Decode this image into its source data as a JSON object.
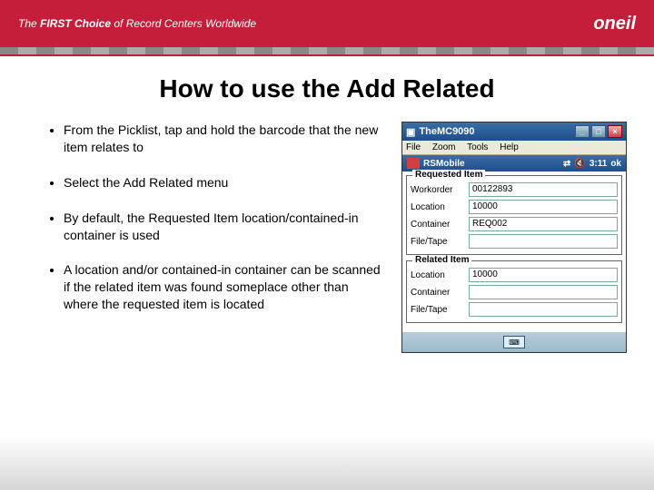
{
  "header": {
    "tagline_pre": "The ",
    "tagline_bold": "FIRST Choice",
    "tagline_post": " of Record Centers Worldwide",
    "logo": "oneil"
  },
  "title": "How to use the Add Related",
  "bullets": [
    "From the Picklist, tap and hold the barcode that the new item relates to",
    "Select the Add Related menu",
    "By default, the Requested Item location/contained-in container is used",
    "A location and/or contained-in container can be scanned if the related item was found someplace other than where the requested item is located"
  ],
  "device": {
    "window_title": "TheMC9090",
    "menu": {
      "file": "File",
      "zoom": "Zoom",
      "tools": "Tools",
      "help": "Help"
    },
    "pda_title": "RSMobile",
    "time": "3:11",
    "ok": "ok",
    "requested_legend": "Requested Item",
    "related_legend": "Related Item",
    "labels": {
      "workorder": "Workorder",
      "location": "Location",
      "container": "Container",
      "filetape": "File/Tape"
    },
    "values": {
      "workorder": "00122893",
      "req_location": "10000",
      "req_container": "REQ002",
      "req_filetape": "",
      "rel_location": "10000",
      "rel_container": "",
      "rel_filetape": ""
    }
  }
}
